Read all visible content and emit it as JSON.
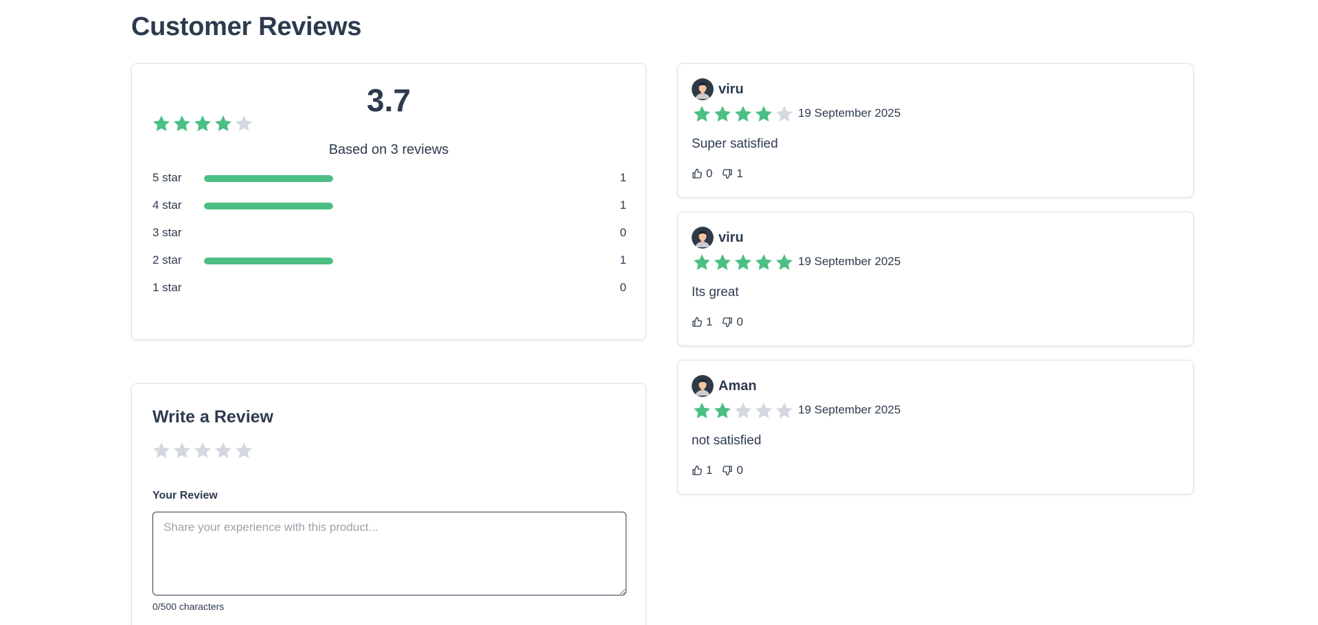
{
  "page": {
    "title": "Customer Reviews"
  },
  "summary": {
    "average": "3.7",
    "average_stars": 4,
    "based_on": "Based on 3 reviews",
    "distribution": [
      {
        "label": "5 star",
        "count": "1",
        "fraction": 1
      },
      {
        "label": "4 star",
        "count": "1",
        "fraction": 1
      },
      {
        "label": "3 star",
        "count": "0",
        "fraction": 0
      },
      {
        "label": "2 star",
        "count": "1",
        "fraction": 1
      },
      {
        "label": "1 star",
        "count": "0",
        "fraction": 0
      }
    ]
  },
  "write_review": {
    "title": "Write a Review",
    "selected_rating": 0,
    "field_label": "Your Review",
    "placeholder": "Share your experience with this product...",
    "value": "",
    "char_count": "0/500 characters"
  },
  "reviews": [
    {
      "name": "viru",
      "rating": 4,
      "date": "19 September 2025",
      "text": "Super satisfied",
      "likes": "0",
      "dislikes": "1"
    },
    {
      "name": "viru",
      "rating": 5,
      "date": "19 September 2025",
      "text": "Its great",
      "likes": "1",
      "dislikes": "0"
    },
    {
      "name": "Aman",
      "rating": 2,
      "date": "19 September 2025",
      "text": "not satisfied",
      "likes": "1",
      "dislikes": "0"
    }
  ],
  "colors": {
    "accent": "#4cbf84",
    "star_empty": "#d4d9df",
    "text": "#2d3a4e"
  },
  "icons": {
    "star": "star-icon",
    "like": "thumbs-up-icon",
    "dislike": "thumbs-down-icon",
    "avatar": "user-avatar"
  }
}
